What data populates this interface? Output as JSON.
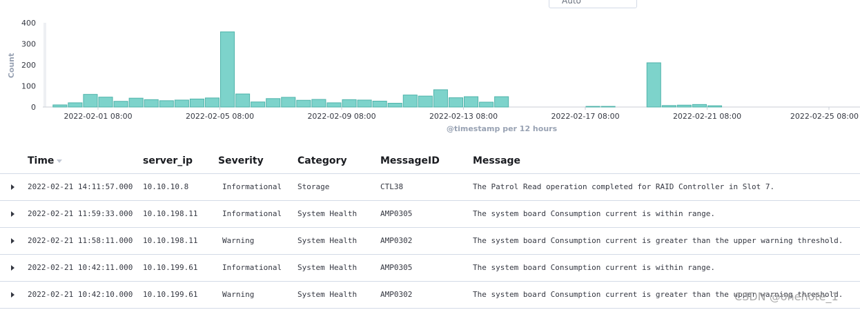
{
  "interval": {
    "selected": "Auto"
  },
  "chart_data": {
    "type": "bar",
    "ylabel": "Count",
    "xlabel": "@timestamp per 12 hours",
    "ylim": [
      0,
      400
    ],
    "yticks": [
      0,
      100,
      200,
      300,
      400
    ],
    "xticks": [
      "2022-02-01 08:00",
      "2022-02-05 08:00",
      "2022-02-09 08:00",
      "2022-02-13 08:00",
      "2022-02-17 08:00",
      "2022-02-21 08:00",
      "2022-02-25 08:00"
    ],
    "bar_color": "#7dd3cb",
    "bar_edge": "#4fb3aa",
    "buckets": [
      {
        "x": "2022-01-30 20:00",
        "value": 10
      },
      {
        "x": "2022-01-31 08:00",
        "value": 20
      },
      {
        "x": "2022-01-31 20:00",
        "value": 60
      },
      {
        "x": "2022-02-01 08:00",
        "value": 47
      },
      {
        "x": "2022-02-01 20:00",
        "value": 27
      },
      {
        "x": "2022-02-02 08:00",
        "value": 42
      },
      {
        "x": "2022-02-02 20:00",
        "value": 35
      },
      {
        "x": "2022-02-03 08:00",
        "value": 30
      },
      {
        "x": "2022-02-03 20:00",
        "value": 33
      },
      {
        "x": "2022-02-04 08:00",
        "value": 38
      },
      {
        "x": "2022-02-04 20:00",
        "value": 43
      },
      {
        "x": "2022-02-05 08:00",
        "value": 357
      },
      {
        "x": "2022-02-05 20:00",
        "value": 62
      },
      {
        "x": "2022-02-06 08:00",
        "value": 24
      },
      {
        "x": "2022-02-06 20:00",
        "value": 40
      },
      {
        "x": "2022-02-07 08:00",
        "value": 46
      },
      {
        "x": "2022-02-07 20:00",
        "value": 32
      },
      {
        "x": "2022-02-08 08:00",
        "value": 36
      },
      {
        "x": "2022-02-08 20:00",
        "value": 20
      },
      {
        "x": "2022-02-09 08:00",
        "value": 35
      },
      {
        "x": "2022-02-09 20:00",
        "value": 33
      },
      {
        "x": "2022-02-10 08:00",
        "value": 28
      },
      {
        "x": "2022-02-10 20:00",
        "value": 18
      },
      {
        "x": "2022-02-11 08:00",
        "value": 57
      },
      {
        "x": "2022-02-11 20:00",
        "value": 52
      },
      {
        "x": "2022-02-12 08:00",
        "value": 82
      },
      {
        "x": "2022-02-12 20:00",
        "value": 44
      },
      {
        "x": "2022-02-13 08:00",
        "value": 49
      },
      {
        "x": "2022-02-13 20:00",
        "value": 23
      },
      {
        "x": "2022-02-14 08:00",
        "value": 49
      },
      {
        "x": "2022-02-17 08:00",
        "value": 3
      },
      {
        "x": "2022-02-17 20:00",
        "value": 3
      },
      {
        "x": "2022-02-19 08:00",
        "value": 210
      },
      {
        "x": "2022-02-19 20:00",
        "value": 7
      },
      {
        "x": "2022-02-20 08:00",
        "value": 9
      },
      {
        "x": "2022-02-20 20:00",
        "value": 12
      },
      {
        "x": "2022-02-21 08:00",
        "value": 6
      }
    ]
  },
  "table": {
    "headers": {
      "time": "Time",
      "server_ip": "server_ip",
      "severity": "Severity",
      "category": "Category",
      "message_id": "MessageID",
      "message": "Message"
    },
    "rows": [
      {
        "time": "2022-02-21 14:11:57.000",
        "server_ip": "10.10.10.8",
        "severity": "Informational",
        "category": "Storage",
        "message_id": "CTL38",
        "message": "The Patrol Read operation completed for RAID Controller in Slot 7."
      },
      {
        "time": "2022-02-21 11:59:33.000",
        "server_ip": "10.10.198.11",
        "severity": "Informational",
        "category": "System Health",
        "message_id": "AMP0305",
        "message": "The system board Consumption current is within range."
      },
      {
        "time": "2022-02-21 11:58:11.000",
        "server_ip": "10.10.198.11",
        "severity": "Warning",
        "category": "System Health",
        "message_id": "AMP0302",
        "message": "The system board Consumption current is greater than the upper warning threshold."
      },
      {
        "time": "2022-02-21 10:42:11.000",
        "server_ip": "10.10.199.61",
        "severity": "Informational",
        "category": "System Health",
        "message_id": "AMP0305",
        "message": "The system board Consumption current is within range."
      },
      {
        "time": "2022-02-21 10:42:10.000",
        "server_ip": "10.10.199.61",
        "severity": "Warning",
        "category": "System Health",
        "message_id": "AMP0302",
        "message": "The system board Consumption current is greater than the upper warning threshold."
      }
    ]
  },
  "watermark": "CSDN @onenote_1"
}
